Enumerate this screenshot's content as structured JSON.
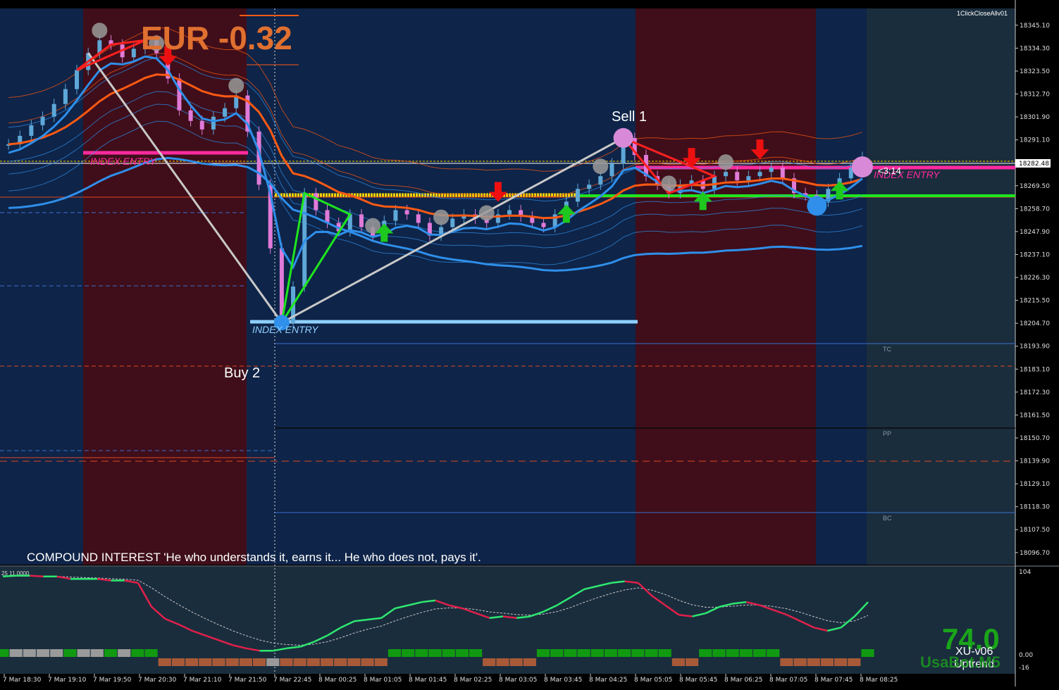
{
  "chart_data": [
    {
      "type": "line",
      "title": "EUR -0.32",
      "ylim": [
        18091,
        18353
      ],
      "y_ticks": [
        18345.1,
        18334.3,
        18323.5,
        18312.7,
        18301.9,
        18291.1,
        18280.3,
        18269.5,
        18258.7,
        18247.9,
        18237.1,
        18226.3,
        18215.5,
        18204.7,
        18193.9,
        18183.1,
        18172.3,
        18161.5,
        18150.7,
        18139.9,
        18129.1,
        18118.3,
        18107.5,
        18096.7
      ],
      "current_price_label": "18282.48",
      "current_price": 18282.48,
      "x_ticks": [
        "7 Mar 18:30",
        "7 Mar 19:10",
        "7 Mar 19:50",
        "7 Mar 20:30",
        "7 Mar 21:10",
        "7 Mar 21:50",
        "7 Mar 22:45",
        "8 Mar 00:25",
        "8 Mar 01:05",
        "8 Mar 01:45",
        "8 Mar 02:25",
        "8 Mar 03:05",
        "8 Mar 03:45",
        "8 Mar 04:25",
        "8 Mar 05:05",
        "8 Mar 05:45",
        "8 Mar 06:25",
        "8 Mar 07:05",
        "8 Mar 07:45",
        "8 Mar 08:25"
      ],
      "close_series": {
        "name": "",
        "values": [
          18289,
          18293,
          18298,
          18302,
          18308,
          18315,
          18324,
          18332,
          18338,
          18336,
          18330,
          18334,
          18338,
          18332,
          18320,
          18305,
          18300,
          18296,
          18302,
          18306,
          18312,
          18295,
          18270,
          18240,
          18205,
          18222,
          18266,
          18258,
          18252,
          18248,
          18256,
          18250,
          18246,
          18253,
          18258,
          18256,
          18252,
          18246,
          18250,
          18254,
          18256,
          18254,
          18252,
          18256,
          18258,
          18255,
          18252,
          18250,
          18256,
          18262,
          18268,
          18270,
          18274,
          18280,
          18292,
          18284,
          18274,
          18270,
          18266,
          18270,
          18272,
          18268,
          18274,
          18276,
          18272,
          18274,
          18276,
          18278,
          18273,
          18266,
          18265,
          18262,
          18268,
          18273,
          18278,
          18283
        ]
      },
      "text_labels": [
        "Buy 2",
        "Sell 1",
        "INDEX ENTRY",
        "INDEX ENTRY",
        "INDEX ENTRY",
        "TC",
        "PP",
        "BC",
        "<3:14",
        "1ClickCloseAllv01"
      ],
      "caption": "COMPOUND INTEREST  'He who understands it, earns it... He who does not, pays it'.",
      "colors": {
        "bg_blue": "#0e2448",
        "bg_red": "#3f0e1a",
        "bg_tail": "#1a2d3d",
        "ma_fast": "#2f8fea",
        "ma_slow": "#ff5a14",
        "gold": "#ffd400",
        "pink": "#ff2aa0",
        "green": "#1ee61e",
        "candle": "#5ea8d8",
        "candle_bear": "#e07ad8"
      }
    },
    {
      "type": "line",
      "title": "",
      "ylim": [
        -16,
        104
      ],
      "y_ticks": [
        104,
        0.0,
        -16
      ],
      "header_label": "25 11.0000",
      "series": [
        {
          "name": "",
          "values": [
            98,
            99,
            99,
            98,
            98,
            95,
            95,
            95,
            93,
            93,
            90,
            60,
            45,
            38,
            30,
            24,
            18,
            12,
            8,
            5,
            5,
            8,
            10,
            16,
            24,
            34,
            42,
            44,
            46,
            58,
            62,
            66,
            68,
            62,
            58,
            52,
            46,
            48,
            46,
            48,
            54,
            62,
            72,
            82,
            86,
            90,
            92,
            90,
            74,
            62,
            50,
            48,
            52,
            60,
            64,
            66,
            62,
            56,
            50,
            42,
            34,
            30,
            34,
            48,
            66
          ]
        }
      ],
      "overlay_label": "XU-v06",
      "overlay_sub": "Uptrend",
      "overlay_value": "74.0",
      "watermark": "UsaBot.M5"
    }
  ]
}
